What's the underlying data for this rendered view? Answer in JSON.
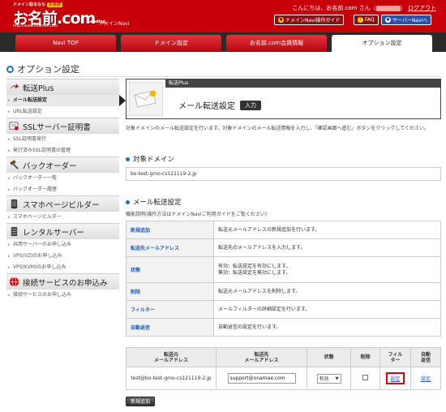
{
  "header": {
    "logo_tagline": "ドメイン取るなら",
    "logo_badge": "お名前",
    "logo_main": "お名前.com",
    "logo_suffix": "Leading",
    "logo_url": "http://www.onamae.com",
    "sub_title": "ドメインNavi",
    "greeting_prefix": "こんにちは、お名前.com さん（",
    "greeting_suffix": "）",
    "logout": "ログアウト",
    "btn_guide": "ドメインNavi操作ガイド",
    "btn_faq": "FAQ",
    "btn_server": "サーバーNaviへ"
  },
  "nav": {
    "tabs": [
      {
        "label": "Navi TOP"
      },
      {
        "label": "ドメイン設定"
      },
      {
        "label": "お名前.com会員情報"
      },
      {
        "label": "オプション設定"
      }
    ]
  },
  "page_title": "オプション設定",
  "sidebar": {
    "sections": [
      {
        "title": "転送Plus",
        "items": [
          "メール転送設定",
          "URL転送設定"
        ]
      },
      {
        "title": "SSLサーバー証明書",
        "items": [
          "SSL証明書発行",
          "発行済みSSL証明書の管理"
        ]
      },
      {
        "title": "バックオーダー",
        "items": [
          "バックオーダー一覧",
          "バックオーダー履歴"
        ]
      },
      {
        "title": "スマホページビルダー",
        "items": [
          "スマホページビルダー"
        ]
      },
      {
        "title": "レンタルサーバー",
        "items": [
          "共用サーバーのお申し込み",
          "VPS(VZ)のお申し込み",
          "VPS(KVM)のお申し込み"
        ]
      },
      {
        "title": "接続サービスのお申込み",
        "items": [
          "接続サービスのお申し込み"
        ]
      }
    ]
  },
  "banner": {
    "label": "転送Plus",
    "title": "メール転送設定",
    "badge": "入力"
  },
  "description": "対象ドメインのメール転送設定を行います。対象ドメインのメール転送情報を入力し、『確認画面へ進む』ボタンをクリックしてください。",
  "target_domain": {
    "title": "対象ドメイン",
    "value": "bo-test-gmo-cs121119-2.jp"
  },
  "mail_forward": {
    "title": "メール転送設定",
    "subtitle": "機能説明(操作方法はドメインNaviご利用ガイドをご覧ください)",
    "functions": [
      {
        "name": "新規追加",
        "desc": "転送元メールアドレスの新規追加を行います。"
      },
      {
        "name": "転送先メールアドレス",
        "desc": "転送先のメールアドレスを入力します。"
      },
      {
        "name": "状態",
        "desc": "有効：転送設定を有効にします。\n無効：転送設定を無効にします。"
      },
      {
        "name": "削除",
        "desc": "転送元メールアドレスを削除します。"
      },
      {
        "name": "フィルター",
        "desc": "メールフィルターの詳細設定を行います。"
      },
      {
        "name": "自動返信",
        "desc": "自動返信の設定を行います。"
      }
    ]
  },
  "records": {
    "headers": {
      "from": "転送元\nメールアドレス",
      "to": "転送先\nメールアドレス",
      "status": "状態",
      "delete": "削除",
      "filter": "フィル\nター",
      "auto": "自動\n返信"
    },
    "rows": [
      {
        "from": "test@bo-test-gmo-cs121119-2.jp",
        "to": "support@onamae.com",
        "status": "有効",
        "filter": "設定",
        "auto": "設定"
      }
    ]
  },
  "add_button": "新規追加",
  "colors": {
    "brand_red": "#c8000a",
    "nav_dark": "#2a2a2a",
    "link_blue": "#1e5fbf",
    "highlight": "#e00000"
  }
}
